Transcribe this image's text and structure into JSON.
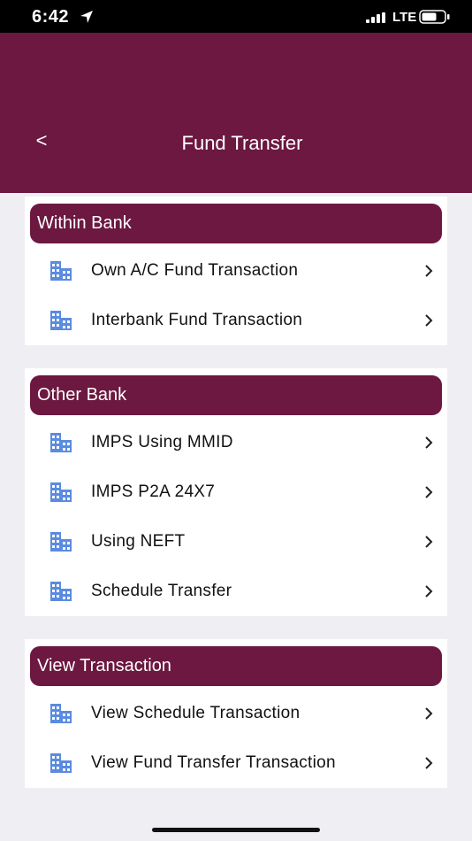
{
  "status": {
    "time": "6:42",
    "network": "LTE"
  },
  "header": {
    "back": "<",
    "title": "Fund Transfer"
  },
  "sections": [
    {
      "title": "Within Bank",
      "items": [
        {
          "label": "Own A/C Fund Transaction",
          "icon": "building-icon"
        },
        {
          "label": "Interbank Fund Transaction",
          "icon": "building-icon"
        }
      ]
    },
    {
      "title": "Other Bank",
      "items": [
        {
          "label": "IMPS Using MMID",
          "icon": "building-icon"
        },
        {
          "label": "IMPS P2A 24X7",
          "icon": "building-icon"
        },
        {
          "label": "Using NEFT",
          "icon": "building-icon"
        },
        {
          "label": "Schedule Transfer",
          "icon": "building-icon"
        }
      ]
    },
    {
      "title": "View Transaction",
      "items": [
        {
          "label": "View Schedule Transaction",
          "icon": "building-icon"
        },
        {
          "label": "View Fund Transfer Transaction",
          "icon": "building-icon"
        }
      ]
    }
  ],
  "colors": {
    "accent": "#6c1840",
    "background": "#efeef3",
    "icon": "#5b8be0"
  }
}
